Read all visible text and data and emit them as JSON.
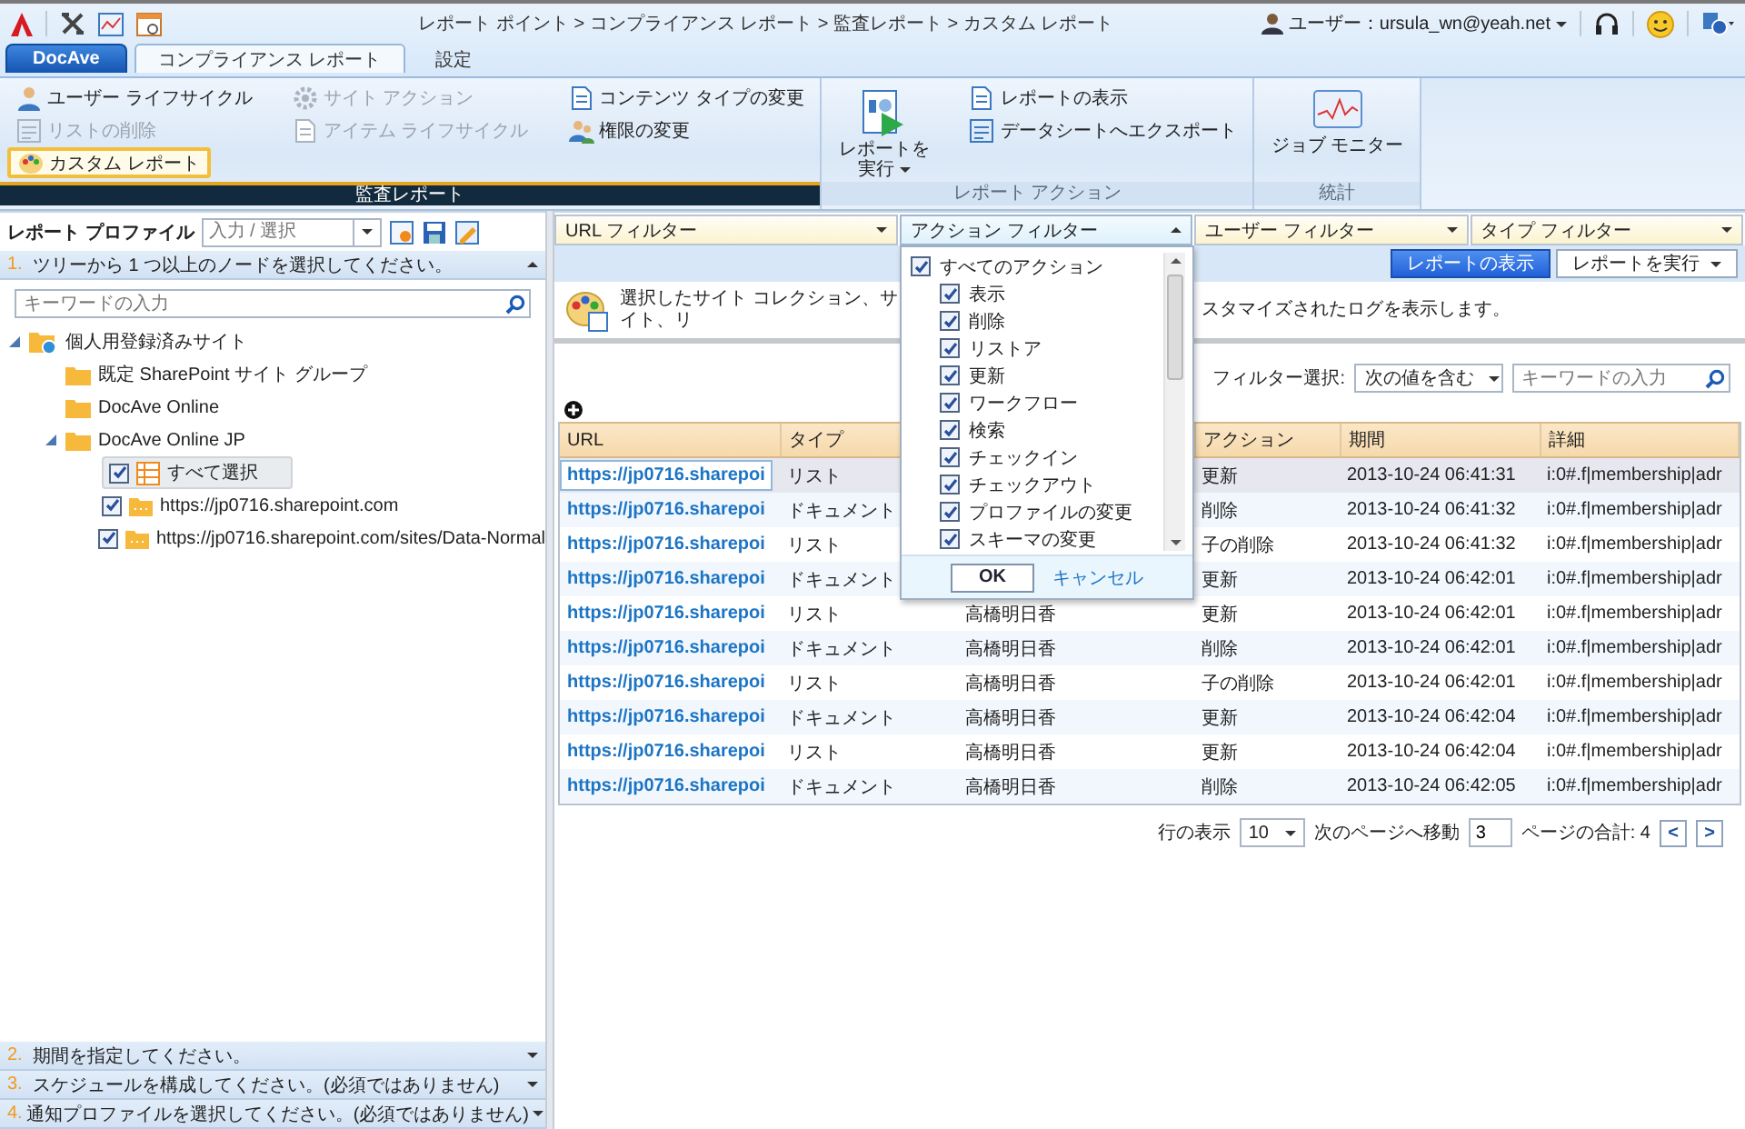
{
  "header": {
    "breadcrumb": "レポート ポイント > コンプライアンス レポート > 監査レポート > カスタム レポート",
    "user": "ユーザー：ursula_wn@yeah.net"
  },
  "app_button": "DocAve",
  "tabs": [
    {
      "label": "コンプライアンス レポート",
      "selected": true
    },
    {
      "label": "設定",
      "selected": false
    }
  ],
  "ribbon": [
    {
      "title": "監査レポート",
      "selected": true,
      "columns": [
        [
          {
            "label": "ユーザー ライフサイクル",
            "disabled": false,
            "selected": false
          },
          {
            "label": "リストの削除",
            "disabled": true,
            "selected": false
          },
          {
            "label": "カスタム レポート",
            "disabled": false,
            "selected": true
          }
        ],
        [
          {
            "label": "サイト アクション",
            "disabled": true,
            "selected": false
          },
          {
            "label": "アイテム ライフサイクル",
            "disabled": true,
            "selected": false
          }
        ],
        [
          {
            "label": "コンテンツ タイプの変更",
            "disabled": false,
            "selected": false
          },
          {
            "label": "権限の変更",
            "disabled": false,
            "selected": false
          }
        ]
      ]
    },
    {
      "title": "レポート アクション",
      "selected": false,
      "large": {
        "lines": [
          "レポートを",
          "実行"
        ],
        "menu": true
      },
      "columns": [
        [
          {
            "label": "レポートの表示",
            "disabled": false,
            "selected": false
          },
          {
            "label": "データシートへエクスポート",
            "disabled": false,
            "selected": false
          }
        ]
      ]
    },
    {
      "title": "統計",
      "selected": false,
      "large": {
        "lines": [
          "ジョブ モニター"
        ],
        "menu": false
      }
    }
  ],
  "left": {
    "profile": {
      "label": "レポート プロファイル",
      "placeholder": "入力 / 選択"
    },
    "steps": [
      {
        "number": "1.",
        "text": "ツリーから 1 つ以上のノードを選択してください。",
        "expanded": true
      },
      {
        "number": "2.",
        "text": "期間を指定してください。",
        "expanded": false
      },
      {
        "number": "3.",
        "text": "スケジュールを構成してください。(必須ではありません)",
        "expanded": false
      },
      {
        "number": "4.",
        "text": "通知プロファイルを選択してください。(必須ではありません)",
        "expanded": false
      }
    ],
    "search": {
      "placeholder": "キーワードの入力"
    },
    "tree": [
      {
        "label": "個人用登録済みサイト",
        "kind": "root",
        "expanded": true,
        "children": [
          {
            "label": "既定 SharePoint サイト グループ",
            "kind": "folder"
          },
          {
            "label": "DocAve Online",
            "kind": "folder"
          },
          {
            "label": "DocAve Online JP",
            "kind": "folder",
            "expanded": true,
            "children": [
              {
                "label": "すべて選択",
                "kind": "select-all",
                "checked": true
              },
              {
                "label": "https://jp0716.sharepoint.com",
                "kind": "site",
                "checked": true
              },
              {
                "label": "https://jp0716.sharepoint.com/sites/Data-Normal",
                "kind": "site",
                "checked": true
              }
            ]
          }
        ]
      }
    ]
  },
  "report": {
    "filters": [
      {
        "label": "URL フィルター",
        "expanded": false
      },
      {
        "label": "アクション フィルター",
        "expanded": true
      },
      {
        "label": "ユーザー フィルター",
        "expanded": false
      },
      {
        "label": "タイプ フィルター",
        "expanded": false
      }
    ],
    "buttons": [
      {
        "label": "レポートの表示",
        "kind": "primary"
      },
      {
        "label": "レポートを実行",
        "kind": "menu"
      }
    ],
    "description": [
      "選択したサイト コレクション、サイト、リ",
      "スタマイズされたログを表示します。"
    ],
    "filter_select": {
      "label": "フィルター選択:",
      "value": "次の値を含む",
      "placeholder": "キーワードの入力"
    },
    "table": {
      "columns": {
        "url": "URL",
        "type": "タイプ",
        "action": "アクション",
        "period": "期間",
        "detail": "詳細"
      },
      "rows": [
        {
          "url": "https://jp0716.sharepoi",
          "type": "リスト",
          "action": "更新",
          "period": "2013-10-24 06:41:31",
          "detail": "i:0#.f|membership|adr",
          "selected": true
        },
        {
          "url": "https://jp0716.sharepoi",
          "type": "ドキュメント",
          "action": "削除",
          "period": "2013-10-24 06:41:32",
          "detail": "i:0#.f|membership|adr",
          "selected": false
        },
        {
          "url": "https://jp0716.sharepoi",
          "type": "リスト",
          "action": "子の削除",
          "period": "2013-10-24 06:41:32",
          "detail": "i:0#.f|membership|adr",
          "selected": false
        },
        {
          "url": "https://jp0716.sharepoi",
          "type": "ドキュメント",
          "action": "更新",
          "period": "2013-10-24 06:42:01",
          "detail": "i:0#.f|membership|adr",
          "selected": false
        },
        {
          "url": "https://jp0716.sharepoi",
          "type": "リスト",
          "user": "高橋明日香",
          "action": "更新",
          "period": "2013-10-24 06:42:01",
          "detail": "i:0#.f|membership|adr",
          "selected": false
        },
        {
          "url": "https://jp0716.sharepoi",
          "type": "ドキュメント",
          "user": "高橋明日香",
          "action": "削除",
          "period": "2013-10-24 06:42:01",
          "detail": "i:0#.f|membership|adr",
          "selected": false
        },
        {
          "url": "https://jp0716.sharepoi",
          "type": "リスト",
          "user": "高橋明日香",
          "action": "子の削除",
          "period": "2013-10-24 06:42:01",
          "detail": "i:0#.f|membership|adr",
          "selected": false
        },
        {
          "url": "https://jp0716.sharepoi",
          "type": "ドキュメント",
          "user": "高橋明日香",
          "action": "更新",
          "period": "2013-10-24 06:42:04",
          "detail": "i:0#.f|membership|adr",
          "selected": false
        },
        {
          "url": "https://jp0716.sharepoi",
          "type": "リスト",
          "user": "高橋明日香",
          "action": "更新",
          "period": "2013-10-24 06:42:04",
          "detail": "i:0#.f|membership|adr",
          "selected": false
        },
        {
          "url": "https://jp0716.sharepoi",
          "type": "ドキュメント",
          "user": "高橋明日香",
          "action": "削除",
          "period": "2013-10-24 06:42:05",
          "detail": "i:0#.f|membership|adr",
          "selected": false
        }
      ]
    },
    "pagination": {
      "rows_label": "行の表示",
      "rows_value": "10",
      "goto_label": "次のページへ移動",
      "page": "3",
      "total": "ページの合計: 4",
      "prev": "<",
      "next": ">"
    },
    "action_menu": {
      "all": {
        "label": "すべてのアクション",
        "checked": true
      },
      "items": [
        {
          "label": "表示",
          "checked": true
        },
        {
          "label": "削除",
          "checked": true
        },
        {
          "label": "リストア",
          "checked": true
        },
        {
          "label": "更新",
          "checked": true
        },
        {
          "label": "ワークフロー",
          "checked": true
        },
        {
          "label": "検索",
          "checked": true
        },
        {
          "label": "チェックイン",
          "checked": true
        },
        {
          "label": "チェックアウト",
          "checked": true
        },
        {
          "label": "プロファイルの変更",
          "checked": true
        },
        {
          "label": "スキーマの変更",
          "checked": true
        }
      ],
      "ok": "OK",
      "cancel": "キャンセル"
    }
  }
}
